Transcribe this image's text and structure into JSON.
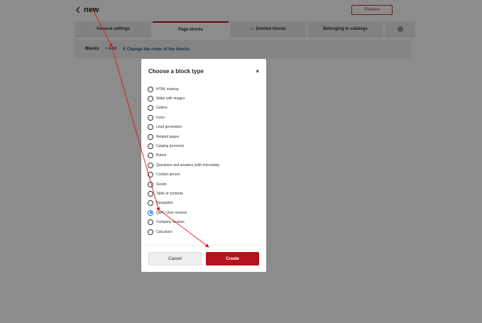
{
  "header": {
    "title": "new",
    "preview_label": "Preview"
  },
  "tabs": [
    {
      "label": "General settings"
    },
    {
      "label": "Page blocks"
    },
    {
      "label": "Deleted blocks"
    },
    {
      "label": "Belonging to catalogs"
    }
  ],
  "blocksbar": {
    "label": "Blocks",
    "add_label": "+ Add",
    "reorder_label": "⠿ Change the order of the blocks"
  },
  "modal": {
    "title": "Choose a block type",
    "close_label": "×",
    "options": [
      {
        "label": "HTML markup",
        "checked": false
      },
      {
        "label": "Slider with images",
        "checked": false
      },
      {
        "label": "Gallery",
        "checked": false
      },
      {
        "label": "Icons",
        "checked": false
      },
      {
        "label": "Lead generation",
        "checked": false
      },
      {
        "label": "Related pages",
        "checked": false
      },
      {
        "label": "Catalog (preview)",
        "checked": false
      },
      {
        "label": "Button",
        "checked": false
      },
      {
        "label": "Questions and answers (with microdata)",
        "checked": false
      },
      {
        "label": "Contact person",
        "checked": false
      },
      {
        "label": "Goods",
        "checked": false
      },
      {
        "label": "Table of contents",
        "checked": false
      },
      {
        "label": "Navigation",
        "checked": false
      },
      {
        "label": "Q&A / User reviews",
        "checked": true
      },
      {
        "label": "Company reviews",
        "checked": false
      },
      {
        "label": "Calculator",
        "checked": false
      }
    ],
    "cancel_label": "Cancel",
    "create_label": "Create"
  },
  "colors": {
    "accent": "#b5121b",
    "link": "#2a5b8a",
    "radio_selected": "#1a73e8",
    "annotation_arrow": "#e0141e"
  }
}
